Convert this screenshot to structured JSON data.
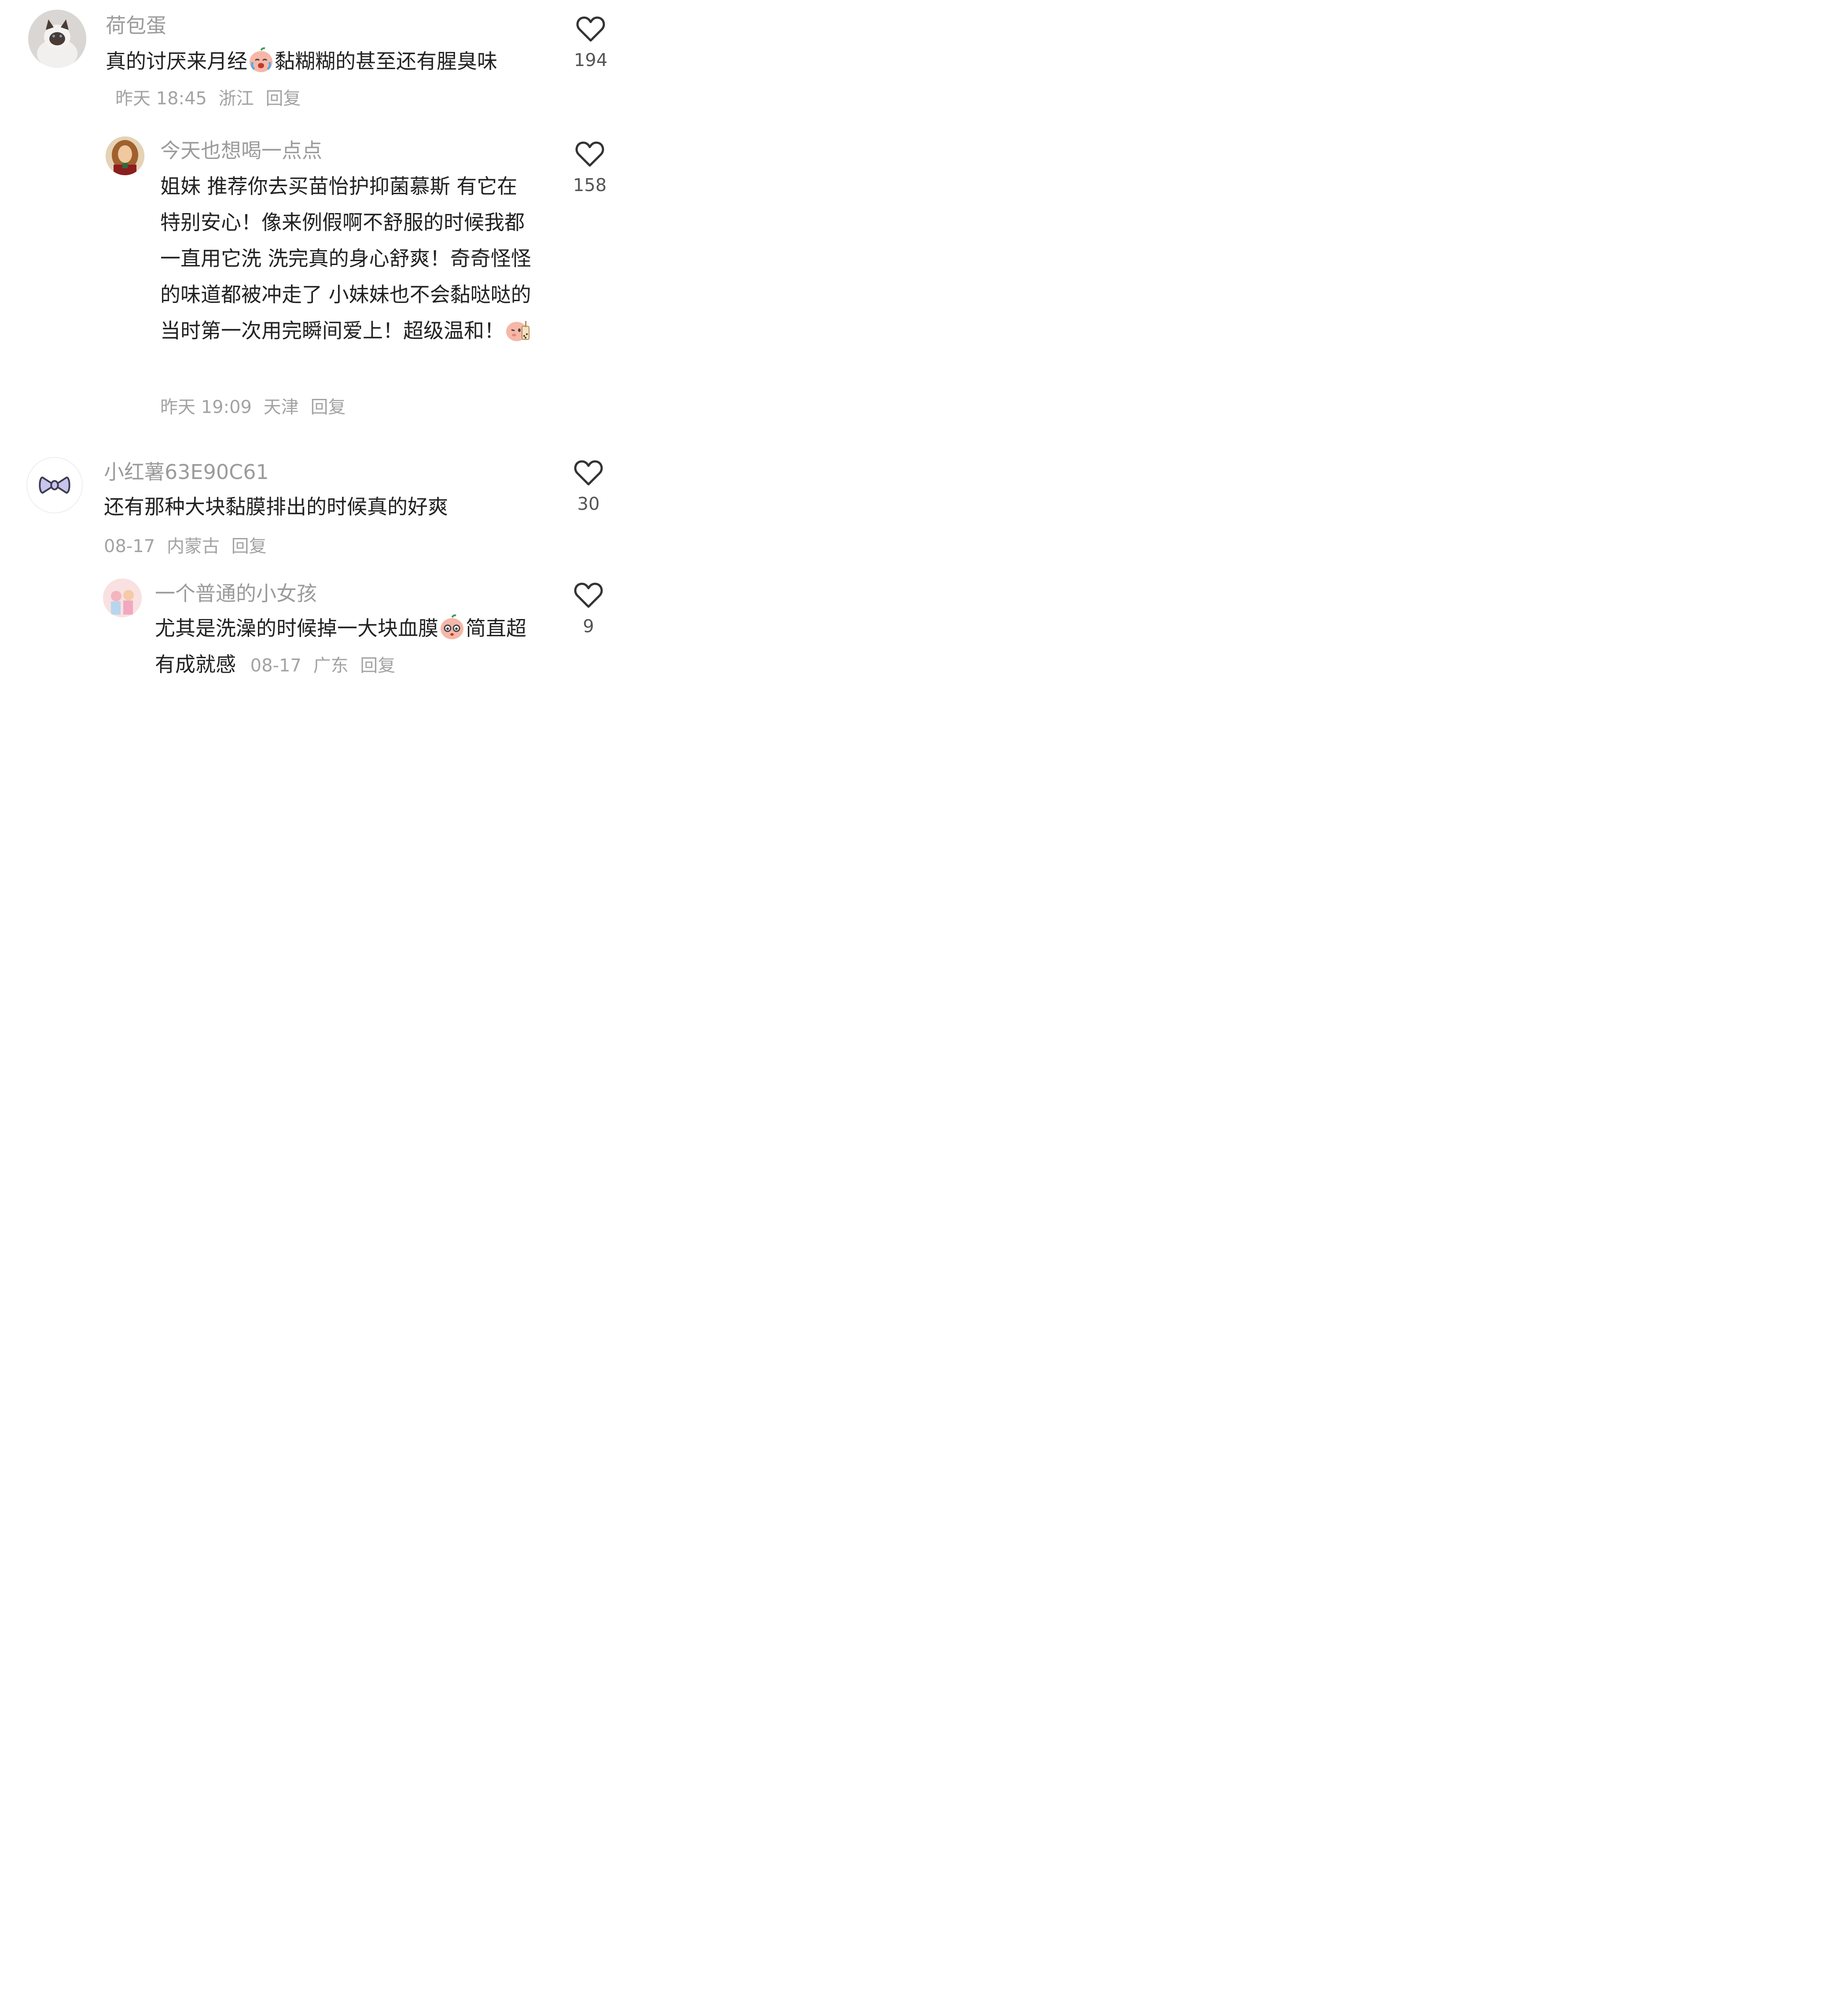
{
  "comments": [
    {
      "username": "荷包蛋",
      "text_a": "真的讨厌来月经",
      "text_b": "黏糊糊的甚至还有腥臭味",
      "time": "昨天 18:45",
      "location": "浙江",
      "reply": "回复",
      "likes": "194"
    },
    {
      "username": "今天也想喝一点点",
      "text": "姐妹 推荐你去买苗怡护抑菌慕斯 有它在特别安心！像来例假啊不舒服的时候我都一直用它洗 洗完真的身心舒爽！奇奇怪怪的味道都被冲走了 小妹妹也不会黏哒哒的 当时第一次用完瞬间爱上！超级温和！",
      "time": "昨天 19:09",
      "location": "天津",
      "reply": "回复",
      "likes": "158"
    },
    {
      "username": "小红薯63E90C61",
      "text": "还有那种大块黏膜排出的时候真的好爽",
      "time": "08-17",
      "location": "内蒙古",
      "reply": "回复",
      "likes": "30"
    },
    {
      "username": "一个普通的小女孩",
      "text_a": "尤其是洗澡的时候掉一大块血膜",
      "text_b": "简直超有成就感",
      "time": "08-17",
      "location": "广东",
      "reply": "回复",
      "likes": "9"
    }
  ],
  "icons": {
    "like": "heart-outline-icon",
    "emoji_cry": "crying-peach-emoji",
    "emoji_tea": "milk-tea-peach-emoji",
    "emoji_shy": "shy-peach-emoji"
  },
  "colors": {
    "username": "#9b9b9b",
    "text": "#222222",
    "meta": "#a3a3a3",
    "peach": "#f6b7a8"
  }
}
